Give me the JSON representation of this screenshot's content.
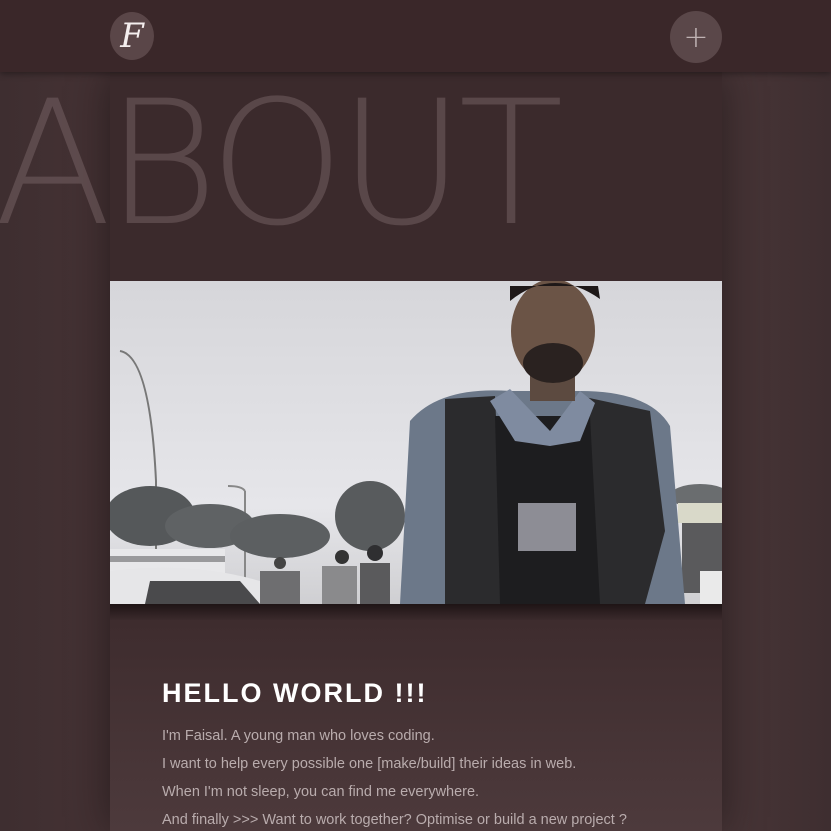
{
  "header": {
    "logo_text": "F",
    "menu_label": "+"
  },
  "hero": {
    "title": "ABOUT"
  },
  "photo": {
    "alt": "Portrait photo"
  },
  "intro": {
    "heading": "HELLO WORLD !!!",
    "lines": [
      "I'm Faisal. A young man who loves coding.",
      "I want to help every possible one [make/build] their ideas in web.",
      "When I'm not sleep, you can find me everywhere.",
      "And finally >>> Want to work together? Optimise or build a new project ?"
    ]
  },
  "colors": {
    "background": "#4a3638",
    "topbar": "#3a2729",
    "heading": "#ffffff",
    "body_text": "#b9acad"
  }
}
